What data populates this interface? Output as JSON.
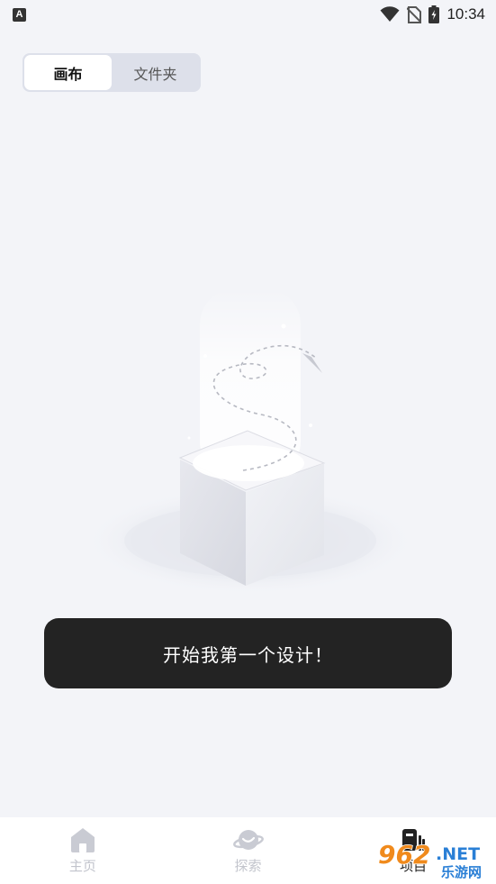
{
  "status_bar": {
    "notification_icon": "a-notification-icon",
    "time": "10:34",
    "icons": [
      "wifi-icon",
      "no-sim-icon",
      "battery-charging-icon"
    ]
  },
  "tabs_switch": {
    "items": [
      {
        "label": "画布",
        "active": true
      },
      {
        "label": "文件夹",
        "active": false
      }
    ]
  },
  "empty_state": {
    "illustration": "open-box-with-paper-plane-illustration",
    "cta_label": "开始我第一个设计！"
  },
  "bottom_nav": {
    "items": [
      {
        "label": "主页",
        "icon": "home-icon",
        "active": false
      },
      {
        "label": "探索",
        "icon": "planet-icon",
        "active": false
      },
      {
        "label": "项目",
        "icon": "project-icon",
        "active": true
      }
    ]
  },
  "watermark": {
    "text": "962.NET",
    "subtext": "乐游网"
  },
  "colors": {
    "background": "#f3f4f8",
    "cta_background": "#232323",
    "nav_inactive": "#c2c4cc",
    "nav_active": "#222222",
    "watermark_orange": "#f08a1c",
    "watermark_blue": "#2a7fd6"
  }
}
